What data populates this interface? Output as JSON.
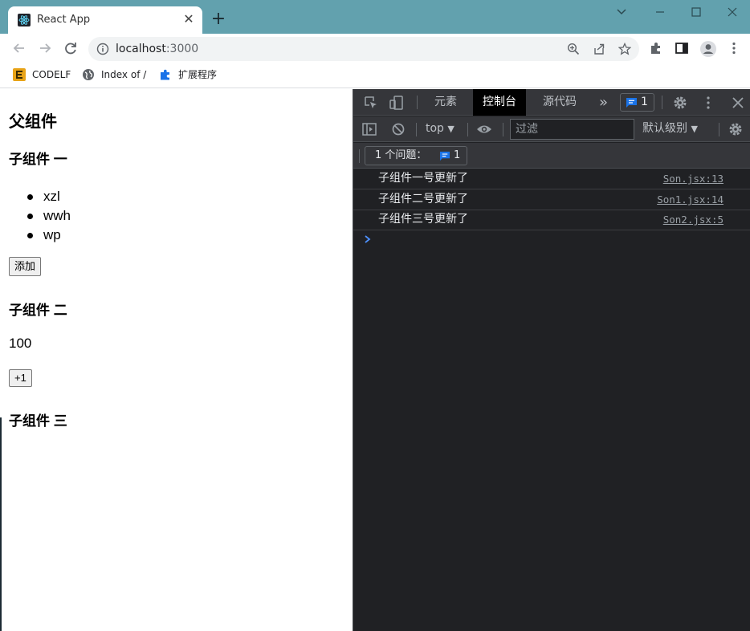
{
  "browser": {
    "tab_title": "React App",
    "url_host": "localhost",
    "url_port": ":3000",
    "bookmarks": [
      {
        "label": "CODELF",
        "icon": "codelf-icon"
      },
      {
        "label": "Index of /",
        "icon": "globe-icon"
      },
      {
        "label": "扩展程序",
        "icon": "puzzle-icon"
      }
    ],
    "tab_bg_color": "#62a1ae"
  },
  "page": {
    "parent_title": "父组件",
    "child1_title": "子组件 一",
    "list_items": [
      "xzl",
      "wwh",
      "wp"
    ],
    "add_button": "添加",
    "child2_title": "子组件 二",
    "count_value": "100",
    "increment_button": "+1",
    "child3_title": "子组件 三"
  },
  "devtools": {
    "tabs": [
      "元素",
      "控制台",
      "源代码"
    ],
    "active_tab": "控制台",
    "more_tabs": "»",
    "badge_count": "1",
    "context": "top",
    "filter_placeholder": "过滤",
    "levels": "默认级别",
    "issues_label": "1 个问题：",
    "issues_count": "1",
    "logs": [
      {
        "message": "子组件一号更新了",
        "source": "Son.jsx:13"
      },
      {
        "message": "子组件二号更新了",
        "source": "Son1.jsx:14"
      },
      {
        "message": "子组件三号更新了",
        "source": "Son2.jsx:5"
      }
    ]
  }
}
